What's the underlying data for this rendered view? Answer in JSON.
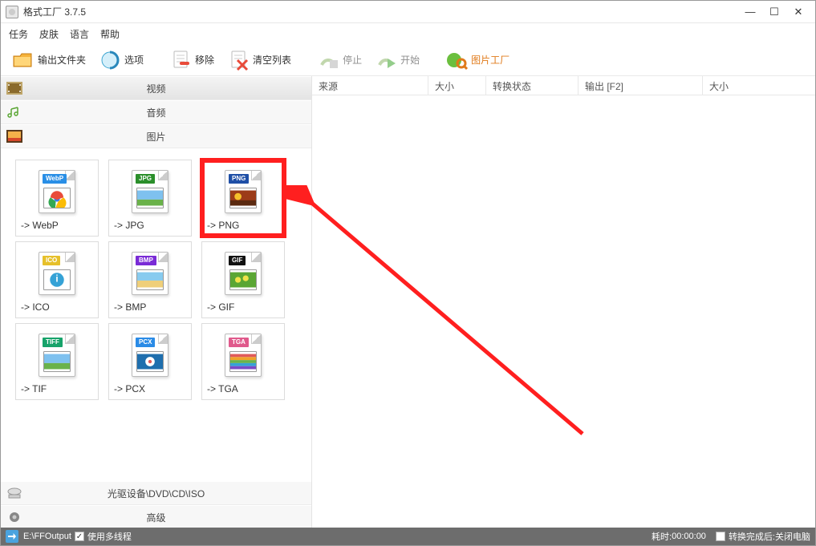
{
  "window": {
    "title": "格式工厂 3.7.5",
    "minimize": "—",
    "maximize": "☐",
    "close": "✕"
  },
  "menubar": {
    "task": "任务",
    "skin": "皮肤",
    "language": "语言",
    "help": "帮助"
  },
  "toolbar": {
    "output_folder": "输出文件夹",
    "options": "选项",
    "remove": "移除",
    "clear": "清空列表",
    "stop": "停止",
    "start": "开始",
    "image_factory": "图片工厂"
  },
  "categories": {
    "video": "视频",
    "audio": "音频",
    "image": "图片",
    "optical": "光驱设备\\DVD\\CD\\ISO",
    "advanced": "高级"
  },
  "tiles": [
    {
      "label": "-> WebP",
      "badge": "WebP",
      "badge_bg": "#2a8fe6",
      "thumb": "chrome"
    },
    {
      "label": "-> JPG",
      "badge": "JPG",
      "badge_bg": "#2b8f2b",
      "thumb": "sky"
    },
    {
      "label": "-> PNG",
      "badge": "PNG",
      "badge_bg": "#1f4fa6",
      "thumb": "autumn",
      "highlight": true
    },
    {
      "label": "-> ICO",
      "badge": "ICO",
      "badge_bg": "#e6c02a",
      "thumb": "info"
    },
    {
      "label": "-> BMP",
      "badge": "BMP",
      "badge_bg": "#7a2bd6",
      "thumb": "beach"
    },
    {
      "label": "-> GIF",
      "badge": "GIF",
      "badge_bg": "#111111",
      "thumb": "flowers"
    },
    {
      "label": "-> TIF",
      "badge": "TIFF",
      "badge_bg": "#17a36a",
      "thumb": "sky"
    },
    {
      "label": "-> PCX",
      "badge": "PCX",
      "badge_bg": "#2a8be6",
      "thumb": "pool"
    },
    {
      "label": "-> TGA",
      "badge": "TGA",
      "badge_bg": "#e05a8c",
      "thumb": "rainbow"
    }
  ],
  "list_headers": {
    "source": "来源",
    "size": "大小",
    "status": "转换状态",
    "output": "输出 [F2]",
    "out_size": "大小"
  },
  "statusbar": {
    "output_path": "E:\\FFOutput",
    "multithread_label": "使用多线程",
    "multithread_checked": true,
    "elapsed_label": "耗时:",
    "elapsed_value": "00:00:00",
    "after_label": "转换完成后:",
    "after_value": "关闭电脑",
    "after_checked": false
  },
  "colors": {
    "highlight": "#ff1f1f"
  }
}
